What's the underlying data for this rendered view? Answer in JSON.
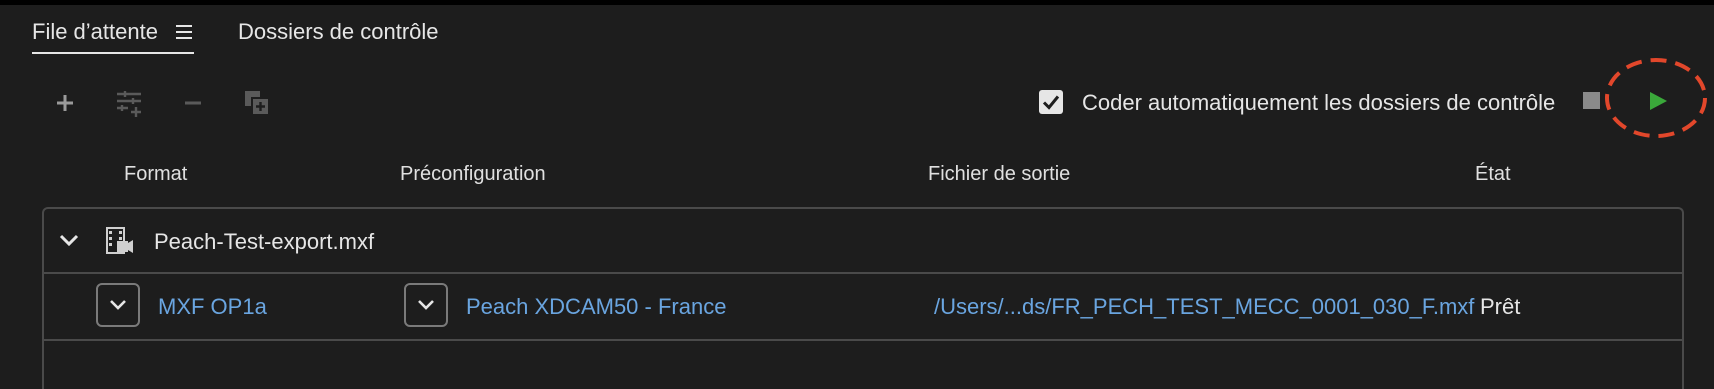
{
  "tabs": {
    "queue": "File d’attente",
    "watch_folders": "Dossiers de contrôle"
  },
  "toolbar": {
    "auto_encode_label": "Coder automatiquement les dossiers de contrôle",
    "auto_encode_checked": true,
    "icons": [
      "plus-icon",
      "preset-settings-icon",
      "minus-icon",
      "duplicate-icon",
      "stop-icon",
      "play-icon"
    ]
  },
  "columns": {
    "format": "Format",
    "preset": "Préconfiguration",
    "output": "Fichier de sortie",
    "state": "État"
  },
  "queue": {
    "item_name": "Peach-Test-export.mxf",
    "row": {
      "format": "MXF OP1a",
      "preset": "Peach XDCAM50 - France",
      "output": "/Users/...ds/FR_PECH_TEST_MECC_0001_030_F.mxf",
      "state": "Prêt"
    }
  },
  "colors": {
    "link": "#6aa5e0",
    "play": "#3aa83a",
    "annotation": "#e2472b"
  }
}
